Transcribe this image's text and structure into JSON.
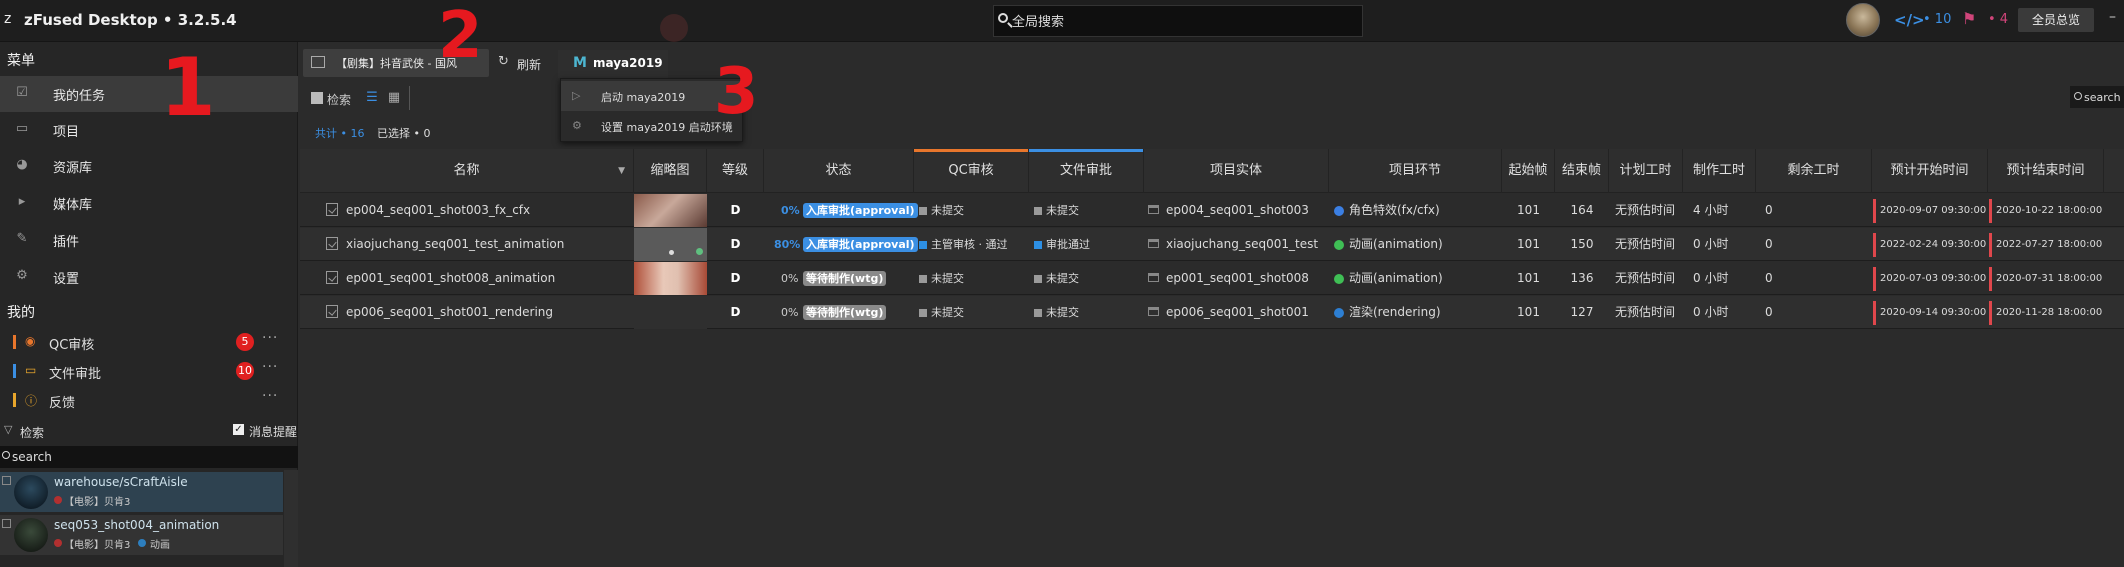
{
  "app": {
    "logo": "z",
    "title": "zFused Desktop • 3.2.5.4"
  },
  "header": {
    "global_search_placeholder": "全局搜索",
    "code_count": "• 10",
    "tag_count": "• 4",
    "overview_label": "全员总览"
  },
  "sidebar": {
    "menu_heading": "菜单",
    "items": [
      {
        "label": "我的任务",
        "icon": "task-check-icon"
      },
      {
        "label": "项目",
        "icon": "project-window-icon"
      },
      {
        "label": "资源库",
        "icon": "asset-library-icon"
      },
      {
        "label": "媒体库",
        "icon": "media-library-icon"
      },
      {
        "label": "插件",
        "icon": "plugin-icon"
      },
      {
        "label": "设置",
        "icon": "gear-icon"
      }
    ],
    "mine_heading": "我的",
    "mine_items": [
      {
        "label": "QC审核",
        "badge": "5",
        "color": "#e8762c",
        "icon": "eye-icon"
      },
      {
        "label": "文件审批",
        "badge": "10",
        "color": "#3b8fe3",
        "icon": "folder-icon"
      },
      {
        "label": "反馈",
        "badge": "",
        "color": "#e8a62c",
        "icon": "info-icon"
      }
    ],
    "filter_label": "检索",
    "remind_label": "消息提醒",
    "search_placeholder": "search",
    "assets": [
      {
        "name": "warehouse/sCraftAisle",
        "project": "【电影】贝肯3",
        "stage": ""
      },
      {
        "name": "seq053_shot004_animation",
        "project": "【电影】贝肯3",
        "stage": "动画"
      }
    ]
  },
  "toolbar": {
    "task_source": "【剧集】抖音武侠 - 国风",
    "refresh_label": "刷新",
    "launch_tab": "maya2019",
    "launch_menu": [
      "启动 maya2019",
      "设置 maya2019 启动环境"
    ],
    "search_label": "检索",
    "total_label": "共计 • 16",
    "selected_label": "已选择 • 0",
    "right_search_placeholder": "search"
  },
  "table": {
    "columns": [
      "名称",
      "缩略图",
      "等级",
      "状态",
      "QC审核",
      "文件审批",
      "项目实体",
      "项目环节",
      "起始帧",
      "结束帧",
      "计划工时",
      "制作工时",
      "剩余工时",
      "预计开始时间",
      "预计结束时间"
    ],
    "rows": [
      {
        "name": "ep004_seq001_shot003_fx_cfx",
        "level": "D",
        "progress": "0%",
        "status": "入库审批(approval)",
        "status_color": "#3b8fe3",
        "qc": "未提交",
        "qc_color": "#9a9a9a",
        "file": "未提交",
        "file_color": "#9a9a9a",
        "entity": "ep004_seq001_shot003",
        "stage": "角色特效(fx/cfx)",
        "stage_color": "#3b7fe3",
        "start_frame": "101",
        "end_frame": "164",
        "plan_hours": "无预估时间",
        "make_hours": "4 小时",
        "remain_hours": "0",
        "start_time": "2020-09-07 09:30:00",
        "end_time": "2020-10-22 18:00:00"
      },
      {
        "name": "xiaojuchang_seq001_test_animation",
        "level": "D",
        "progress": "80%",
        "status": "入库审批(approval)",
        "status_color": "#3b8fe3",
        "qc": "主管审核 · 通过",
        "qc_color": "#2d8fe3",
        "file": "审批通过",
        "file_color": "#2d8fe3",
        "entity": "xiaojuchang_seq001_test",
        "stage": "动画(animation)",
        "stage_color": "#3fbf55",
        "start_frame": "101",
        "end_frame": "150",
        "plan_hours": "无预估时间",
        "make_hours": "0 小时",
        "remain_hours": "0",
        "start_time": "2022-02-24 09:30:00",
        "end_time": "2022-07-27 18:00:00"
      },
      {
        "name": "ep001_seq001_shot008_animation",
        "level": "D",
        "progress": "0%",
        "status": "等待制作(wtg)",
        "status_color": "#8a8a8a",
        "qc": "未提交",
        "qc_color": "#9a9a9a",
        "file": "未提交",
        "file_color": "#9a9a9a",
        "entity": "ep001_seq001_shot008",
        "stage": "动画(animation)",
        "stage_color": "#3fbf55",
        "start_frame": "101",
        "end_frame": "136",
        "plan_hours": "无预估时间",
        "make_hours": "0 小时",
        "remain_hours": "0",
        "start_time": "2020-07-03 09:30:00",
        "end_time": "2020-07-31 18:00:00"
      },
      {
        "name": "ep006_seq001_shot001_rendering",
        "level": "D",
        "progress": "0%",
        "status": "等待制作(wtg)",
        "status_color": "#8a8a8a",
        "qc": "未提交",
        "qc_color": "#9a9a9a",
        "file": "未提交",
        "file_color": "#9a9a9a",
        "entity": "ep006_seq001_shot001",
        "stage": "渲染(rendering)",
        "stage_color": "#2d7fd3",
        "start_frame": "101",
        "end_frame": "127",
        "plan_hours": "无预估时间",
        "make_hours": "0 小时",
        "remain_hours": "0",
        "start_time": "2020-09-14 09:30:00",
        "end_time": "2020-11-28 18:00:00"
      }
    ]
  },
  "annotations": [
    "1",
    "2",
    "3"
  ]
}
